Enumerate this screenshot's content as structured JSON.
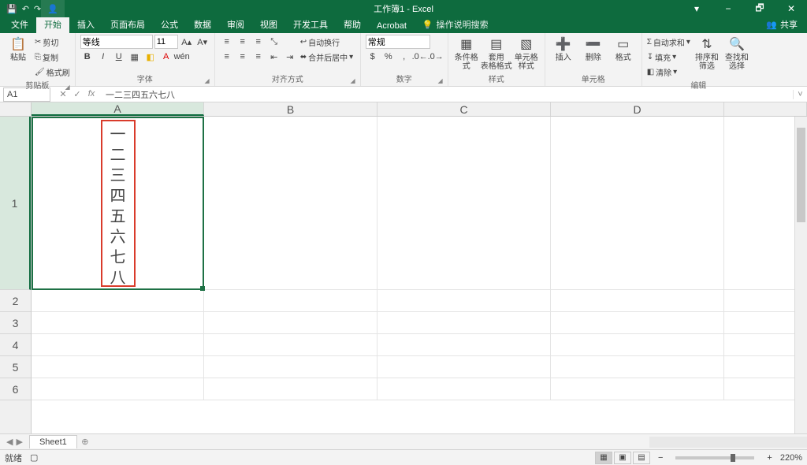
{
  "title": "工作簿1 - Excel",
  "qat": {
    "save": "💾",
    "undo": "↶",
    "redo": "↷"
  },
  "win": {
    "min": "−",
    "max": "▢",
    "close": "✕",
    "ribbonopt": "▾",
    "restore": "🗗"
  },
  "share": "共享",
  "tabs": {
    "file": "文件",
    "home": "开始",
    "insert": "插入",
    "layout": "页面布局",
    "formulas": "公式",
    "data": "数据",
    "review": "审阅",
    "view": "视图",
    "dev": "开发工具",
    "help": "帮助",
    "acrobat": "Acrobat",
    "tell": "操作说明搜索"
  },
  "ribbon": {
    "clipboard": {
      "paste": "粘贴",
      "cut": "剪切",
      "copy": "复制",
      "painter": "格式刷",
      "label": "剪贴板"
    },
    "font": {
      "name": "等线",
      "size": "11",
      "label": "字体"
    },
    "align": {
      "wrap": "自动换行",
      "merge": "合并后居中",
      "label": "对齐方式"
    },
    "number": {
      "format": "常规",
      "label": "数字"
    },
    "styles": {
      "cond": "条件格式",
      "table": "套用\n表格格式",
      "cell": "单元格样式",
      "label": "样式"
    },
    "cells": {
      "insert": "插入",
      "delete": "删除",
      "format": "格式",
      "label": "单元格"
    },
    "editing": {
      "sum": "自动求和",
      "fill": "填充",
      "clear": "清除",
      "sort": "排序和筛选",
      "find": "查找和选择",
      "label": "编辑"
    }
  },
  "namebox": "A1",
  "formula": "一二三四五六七八",
  "columns": [
    "A",
    "B",
    "C",
    "D"
  ],
  "rows": [
    "1",
    "2",
    "3",
    "4",
    "5",
    "6"
  ],
  "cellA1_chars": [
    "一",
    "二",
    "三",
    "四",
    "五",
    "六",
    "七",
    "八"
  ],
  "sheet": "Sheet1",
  "status": {
    "ready": "就绪",
    "zoom": "220%"
  }
}
